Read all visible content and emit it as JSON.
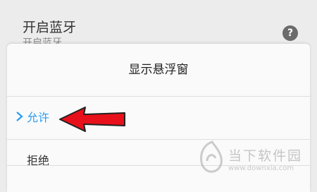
{
  "background_setting": {
    "title": "开启蓝牙",
    "subtitle": "开启蓝牙",
    "help_icon": "question-circle-icon",
    "help_glyph": "?"
  },
  "dialog": {
    "title": "显示悬浮窗",
    "options": [
      {
        "label": "允许",
        "selected": true
      },
      {
        "label": "拒绝",
        "selected": false
      }
    ]
  },
  "annotation": {
    "icon": "red-arrow-icon",
    "color": "#e8101a"
  },
  "watermark": {
    "text": "当下软件园",
    "url": "www.downxia.com"
  },
  "colors": {
    "accent": "#2a9df4",
    "background": "#ececec",
    "dialog": "#fafafa"
  }
}
